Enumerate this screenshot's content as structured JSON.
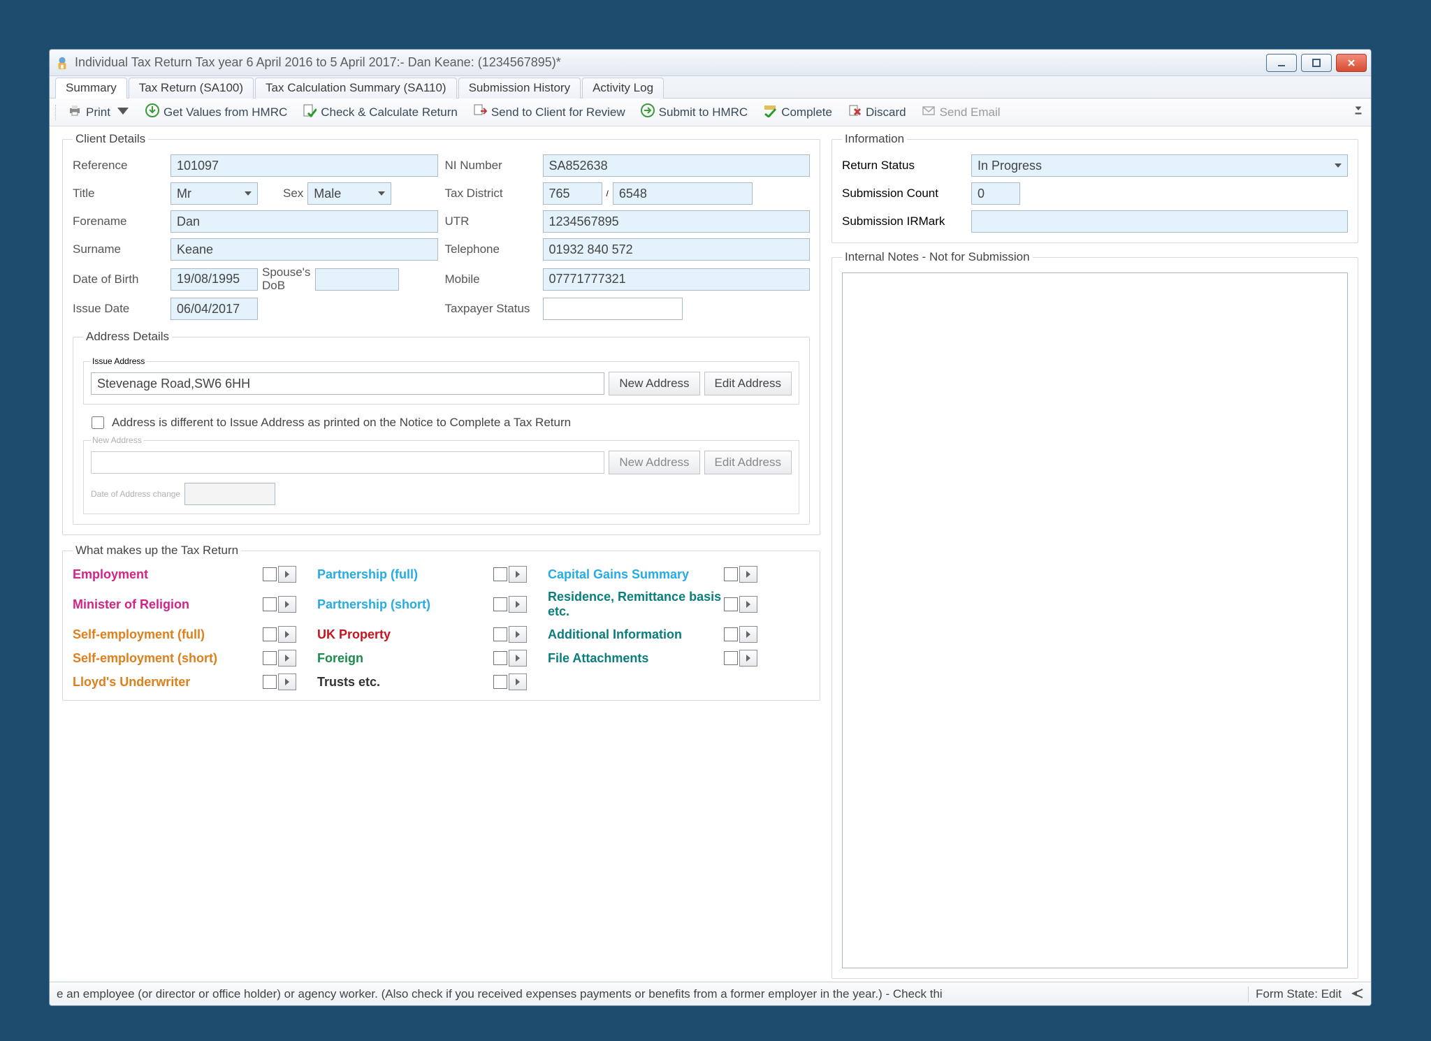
{
  "window": {
    "title": "Individual Tax Return Tax year 6 April 2016 to 5 April 2017:- Dan Keane: (1234567895)*"
  },
  "tabs": [
    {
      "label": "Summary",
      "active": true
    },
    {
      "label": "Tax Return (SA100)"
    },
    {
      "label": "Tax Calculation Summary (SA110)"
    },
    {
      "label": "Submission History"
    },
    {
      "label": "Activity Log"
    }
  ],
  "toolbar": {
    "print": "Print",
    "getvalues": "Get Values from HMRC",
    "check": "Check & Calculate Return",
    "sendreview": "Send to Client for Review",
    "submit": "Submit to HMRC",
    "complete": "Complete",
    "discard": "Discard",
    "sendemail": "Send Email"
  },
  "clientDetails": {
    "legend": "Client Details",
    "fields": {
      "reference_label": "Reference",
      "reference": "101097",
      "ni_label": "NI Number",
      "ni": "SA852638",
      "title_label": "Title",
      "title": "Mr",
      "sex_label": "Sex",
      "sex": "Male",
      "taxdistrict_label": "Tax District",
      "taxdistrict_a": "765",
      "taxdistrict_b": "6548",
      "forename_label": "Forename",
      "forename": "Dan",
      "utr_label": "UTR",
      "utr": "1234567895",
      "surname_label": "Surname",
      "surname": "Keane",
      "telephone_label": "Telephone",
      "telephone": "01932 840 572",
      "dob_label": "Date of Birth",
      "dob": "19/08/1995",
      "spousedob_label": "Spouse's DoB",
      "spousedob": "",
      "mobile_label": "Mobile",
      "mobile": "07771777321",
      "issuedate_label": "Issue Date",
      "issuedate": "06/04/2017",
      "taxpayerstatus_label": "Taxpayer Status",
      "taxpayerstatus": ""
    }
  },
  "addressDetails": {
    "legend": "Address Details",
    "issue_legend": "Issue Address",
    "issue_address": "Stevenage Road,SW6 6HH",
    "new_address_btn": "New Address",
    "edit_address_btn": "Edit Address",
    "diff_checkbox_label": "Address is different to Issue Address as printed on the Notice to Complete a Tax Return",
    "new_legend": "New Address",
    "date_change_label": "Date of Address change"
  },
  "makeup": {
    "legend": "What makes up the Tax Return",
    "items": [
      {
        "label": "Employment",
        "color": "c-magenta"
      },
      {
        "label": "Partnership (full)",
        "color": "c-cyan"
      },
      {
        "label": "Capital Gains Summary",
        "color": "c-cyan"
      },
      {
        "label": "Minister of Religion",
        "color": "c-magenta"
      },
      {
        "label": "Partnership (short)",
        "color": "c-cyan"
      },
      {
        "label": "Residence, Remittance basis etc.",
        "color": "c-teal"
      },
      {
        "label": "Self-employment (full)",
        "color": "c-orange"
      },
      {
        "label": "UK Property",
        "color": "c-red"
      },
      {
        "label": "Additional Information",
        "color": "c-teal"
      },
      {
        "label": "Self-employment (short)",
        "color": "c-orange"
      },
      {
        "label": "Foreign",
        "color": "c-green"
      },
      {
        "label": "File Attachments",
        "color": "c-teal"
      },
      {
        "label": "Lloyd's Underwriter",
        "color": "c-orange"
      },
      {
        "label": "Trusts etc.",
        "color": "c-black"
      }
    ]
  },
  "information": {
    "legend": "Information",
    "return_status_label": "Return Status",
    "return_status": "In Progress",
    "submission_count_label": "Submission Count",
    "submission_count": "0",
    "submission_irmark_label": "Submission IRMark",
    "submission_irmark": ""
  },
  "notes": {
    "legend": "Internal Notes - Not for Submission",
    "value": ""
  },
  "statusbar": {
    "left": "e an employee (or director or office holder) or agency worker. (Also check if you received expenses payments or benefits from a former employer in the year.) - Check thi",
    "right": "Form State: Edit"
  }
}
